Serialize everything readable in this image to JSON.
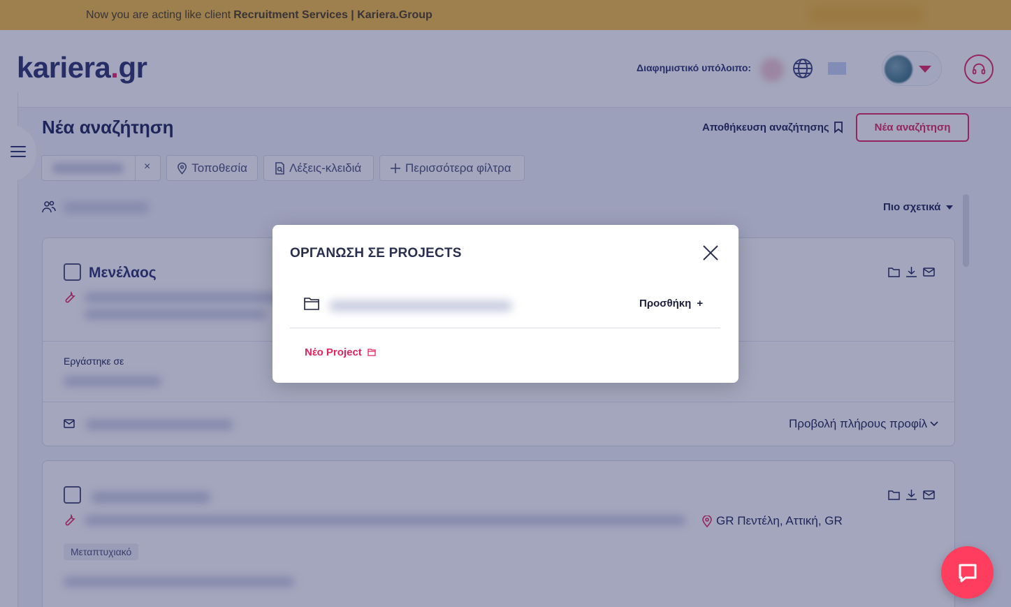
{
  "banner": {
    "prefix": "Now you are acting like client",
    "client": "Recruitment Services | Kariera.Group"
  },
  "header": {
    "logo_main": "kariera",
    "logo_dot": ".",
    "logo_tld": "gr",
    "balance_label": "Διαφημιστικό υπόλοιπο:"
  },
  "search": {
    "title": "Νέα αναζήτηση",
    "save_label": "Αποθήκευση αναζήτησης",
    "new_search_label": "Νέα αναζήτηση",
    "filters": {
      "location": "Τοποθεσία",
      "keywords": "Λέξεις-κλειδιά",
      "more": "Περισσότερα φίλτρα",
      "clear": "×"
    },
    "sort_label": "Πιο σχετικά"
  },
  "cards": [
    {
      "name": "Μενέλαος",
      "worked_label": "Εργάστηκε σε",
      "view_profile": "Προβολή πλήρους προφίλ"
    },
    {
      "location": "GR Πεντέλη, Αττική, GR",
      "tag": "Μεταπτυχιακό"
    }
  ],
  "modal": {
    "title": "ΟΡΓΑΝΩΣΗ ΣΕ PROJECTS",
    "add_label": "Προσθήκη",
    "add_plus": "+",
    "new_project_label": "Νέο Project"
  },
  "colors": {
    "accent": "#e4245f",
    "banner": "#f5bd3f",
    "navy": "#2a2f6b",
    "overlay": "rgba(36,42,98,0.42)"
  }
}
